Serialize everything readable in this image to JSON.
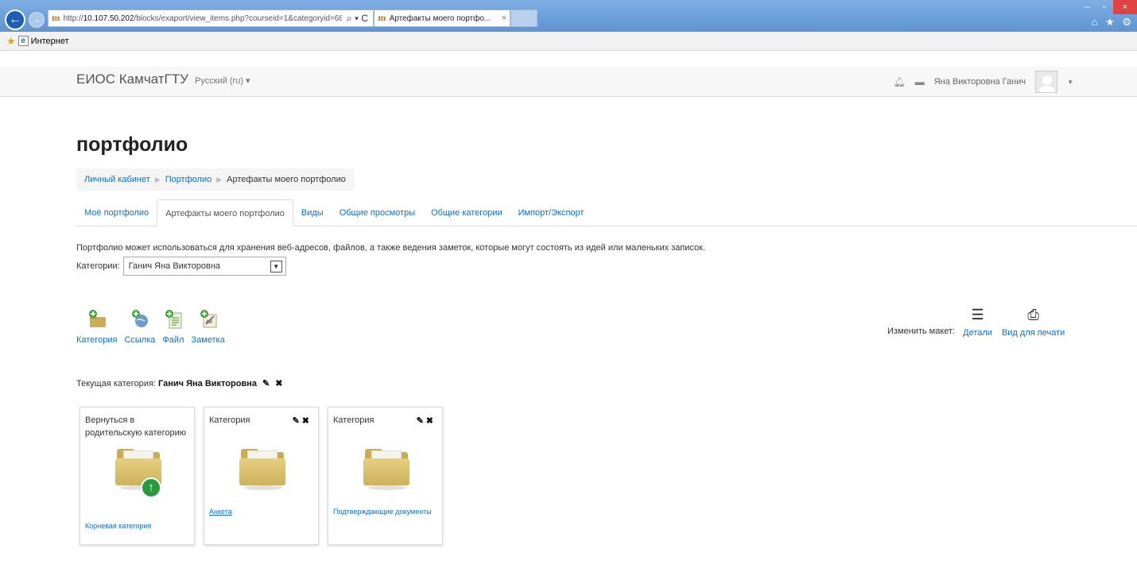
{
  "browser": {
    "url_prefix": "http://",
    "url_host": "10.107.50.202",
    "url_path": "/blocks/exaport/view_items.php?courseid=1&categoryid=68",
    "address_icons": "⌕ ▾ C",
    "tab_title": "Артефакты моего портфо...",
    "tab_close": "×",
    "favorites_label": "Интернет",
    "window_controls": [
      "–",
      "▫",
      "×"
    ],
    "chrome_icons": "⌂ ★ ⚙"
  },
  "navbar": {
    "brand": "ЕИОС КамчатГТУ",
    "language": "Русский (ru) ▾",
    "user_name": "Яна Викторовна Ганич",
    "user_caret": "▼"
  },
  "page": {
    "title": "портфолио",
    "breadcrumb": [
      "Личный кабинет",
      "Портфолио",
      "Артефакты моего портфолио"
    ],
    "breadcrumb_sep": "▶",
    "tabs": [
      "Моё портфолио",
      "Артефакты моего портфолио",
      "Виды",
      "Общие просмотры",
      "Общие категории",
      "Импорт/Экспорт"
    ],
    "active_tab": 1,
    "intro": "Портфолио может использоваться для хранения веб-адресов, файлов, а также ведения заметок, которые могут состоять из идей или маленьких записок.",
    "categories_label": "Категории:",
    "categories_selected": "Ганич Яна Викторовна"
  },
  "actions": {
    "category": "Категория",
    "link": "Ссылка",
    "file": "Файл",
    "note": "Заметка"
  },
  "layout": {
    "caption": "Изменить макет:",
    "details": "Детали",
    "print": "Вид для печати"
  },
  "current": {
    "label": "Текущая категория:",
    "name": "Ганич Яна Викторовна"
  },
  "cards": [
    {
      "title": "Вернуться в родительскую категорию",
      "link": "Корневая категория"
    },
    {
      "title": "Категория",
      "link": "Анкета"
    },
    {
      "title": "Категория",
      "link": "Подтверждающие документы"
    }
  ],
  "colors": {
    "link": "#0f6fc5",
    "folder": "#c9ad58",
    "up_badge": "#2a9a3f",
    "titlebar": "#6fa0d8"
  }
}
